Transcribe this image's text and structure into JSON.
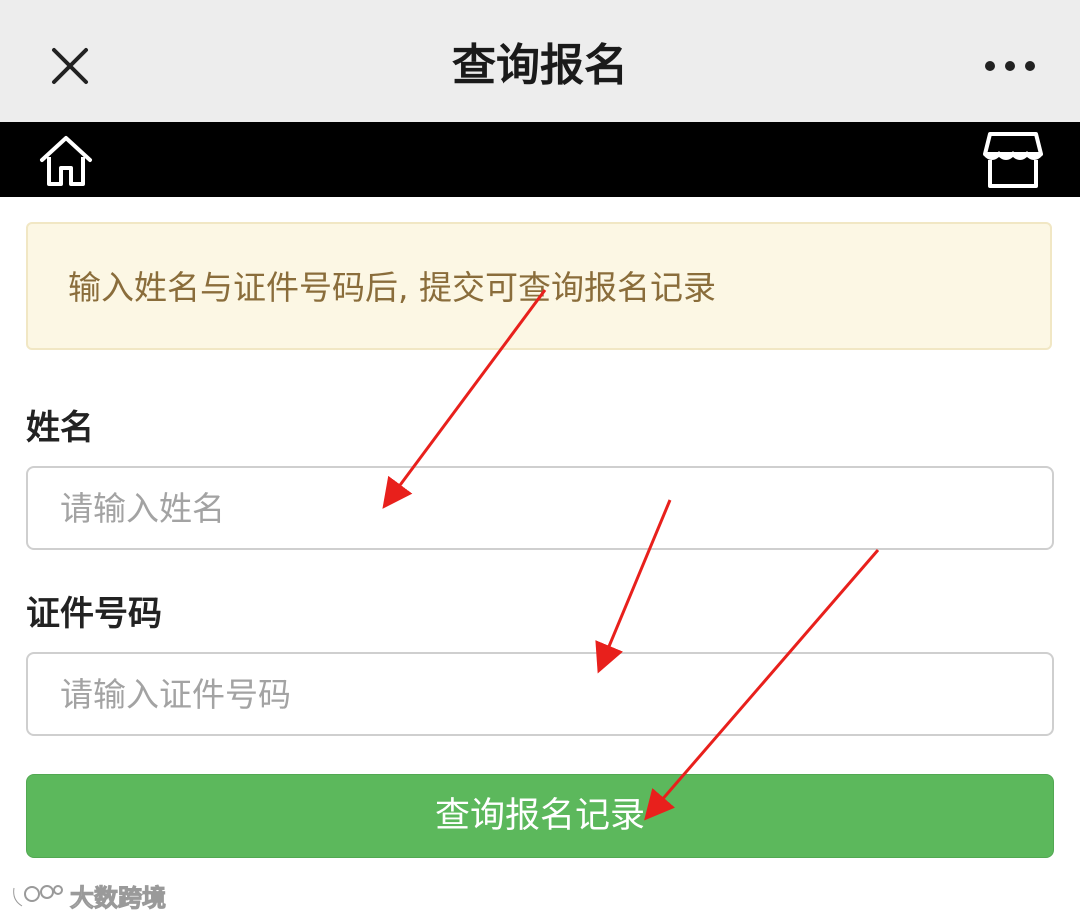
{
  "header": {
    "title": "查询报名",
    "close_icon": "close-icon",
    "more_icon": "more-icon"
  },
  "toolbar": {
    "home_icon": "home-icon",
    "shop_icon": "shop-icon"
  },
  "notice": {
    "text": "输入姓名与证件号码后, 提交可查询报名记录"
  },
  "form": {
    "name_label": "姓名",
    "name_placeholder": "请输入姓名",
    "name_value": "",
    "id_label": "证件号码",
    "id_placeholder": "请输入证件号码",
    "id_value": "",
    "submit_label": "查询报名记录"
  },
  "watermark": {
    "text": "大数跨境"
  },
  "colors": {
    "titlebar_bg": "#ededed",
    "toolbar_bg": "#000000",
    "notice_bg": "#fcf7e4",
    "notice_text": "#8a6d3b",
    "button_green": "#5cb85c",
    "annotation_arrow": "#e8201c"
  }
}
